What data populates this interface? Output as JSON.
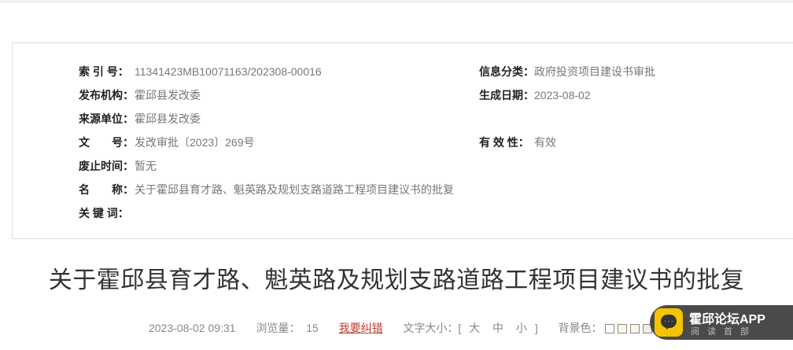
{
  "info": {
    "index_label": "索 引 号：",
    "index_value": "11341423MB10071163/202308-00016",
    "publisher_label": "发布机构：",
    "publisher_value": "霍邱县发改委",
    "source_label": "来源单位：",
    "source_value": "霍邱县发改委",
    "docno_label": "文　　号：",
    "docno_value": "发改审批〔2023〕269号",
    "abolish_label": "废止时间：",
    "abolish_value": "暂无",
    "name_label": "名　　称：",
    "name_value": "关于霍邱县育才路、魁英路及规划支路道路工程项目建议书的批复",
    "keywords_label": "关 键 词：",
    "keywords_value": "",
    "category_label": "信息分类：",
    "category_value": "政府投资项目建设书审批",
    "created_label": "生成日期：",
    "created_value": "2023-08-02",
    "validity_label": "有 效 性：",
    "validity_value": "有效"
  },
  "article": {
    "title": "关于霍邱县育才路、魁英路及规划支路道路工程项目建议书的批复",
    "datetime": "2023-08-02 09:31",
    "views_label": "浏览量：",
    "views_value": "15",
    "report_link": "我要纠错",
    "font_size_label": "文字大小：[",
    "font_large": "大",
    "font_medium": "中",
    "font_small": "小",
    "font_size_close": "]",
    "bg_label": "背景色：",
    "bg_colors": [
      "#ffffff",
      "#fafae6",
      "#fdf2e6",
      "#f6eae6",
      "#eef6ee",
      "#e6f2fa"
    ]
  },
  "app_badge": {
    "title": "霍邱论坛APP",
    "subtitle": "阅读首部",
    "icon": "chat-bubble-icon",
    "icon_color": "#f5c400"
  }
}
